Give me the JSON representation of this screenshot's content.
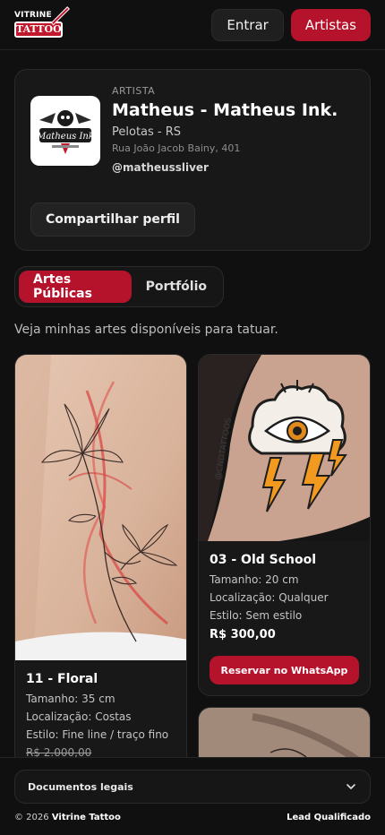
{
  "header": {
    "logo_top": "VITRINE",
    "logo_main": "TATTOO",
    "login_label": "Entrar",
    "artists_label": "Artistas"
  },
  "profile": {
    "logo_text": "Matheus Ink",
    "role": "ARTISTA",
    "name": "Matheus - Matheus Ink.",
    "city": "Pelotas - RS",
    "address": "Rua João Jacob Bainy, 401",
    "handle": "@matheussliver",
    "share_label": "Compartilhar perfil"
  },
  "tabs": [
    {
      "label": "Artes Públicas",
      "active": true
    },
    {
      "label": "Portfólio",
      "active": false
    }
  ],
  "intro": "Veja minhas artes disponíveis para tatuar.",
  "cards": [
    {
      "title": "11 - Floral",
      "size": "Tamanho: 35 cm",
      "location": "Localização: Costas",
      "style": "Estilo: Fine line / traço fino",
      "price": "R$ 2.000,00"
    },
    {
      "title": "03 - Old School",
      "size": "Tamanho: 20 cm",
      "location": "Localização: Qualquer",
      "style": "Estilo: Sem estilo",
      "price": "R$ 300,00",
      "button": "Reservar no WhatsApp",
      "watermark": "@CNDTATTOOS"
    }
  ],
  "footer": {
    "legal_label": "Documentos legais",
    "copyright_prefix": "© 2026",
    "copyright_brand": "Vitrine Tattoo",
    "lead": "Lead Qualificado"
  },
  "colors": {
    "accent": "#b5122b",
    "background": "#101010",
    "card": "#181818"
  }
}
